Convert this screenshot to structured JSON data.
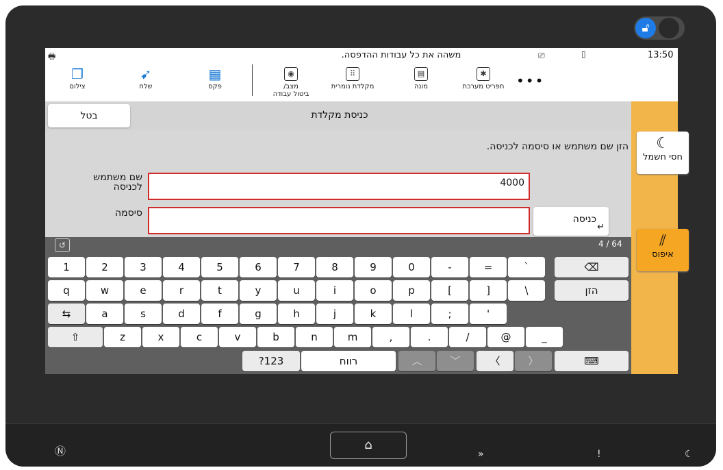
{
  "status": {
    "message": "משהה את כל עבודות ההדפסה.",
    "time": "13:50"
  },
  "functions": [
    {
      "label": "צילום",
      "icon": "copy-icon"
    },
    {
      "label": "שלח",
      "icon": "send-icon"
    },
    {
      "label": "פקס",
      "icon": "fax-icon"
    }
  ],
  "tools": [
    {
      "label_line1": "מצב/",
      "label_line2": "ביטול עבודה",
      "icon": "eye-icon"
    },
    {
      "label": "מקלדת נומרית",
      "icon": "numeric-keypad-icon"
    },
    {
      "label": "מונה",
      "icon": "counter-icon"
    },
    {
      "label": "תפריט מערכת",
      "icon": "system-menu-icon"
    }
  ],
  "more_label": "•••",
  "title_row": {
    "cancel_label": "בטל",
    "title": "כניסת מקלדת"
  },
  "login": {
    "instruction": "הזן שם משתמש או סיסמה לכניסה.",
    "username_label_line1": "שם משתמש",
    "username_label_line2": "לכניסה",
    "username_value": "4000",
    "password_label": "סיסמה",
    "password_value": "",
    "enter_label": "כניסה"
  },
  "keyboard": {
    "char_count": "4 / 64",
    "row1": [
      "1",
      "2",
      "3",
      "4",
      "5",
      "6",
      "7",
      "8",
      "9",
      "0",
      "-",
      "=",
      "`"
    ],
    "row2": [
      "q",
      "w",
      "e",
      "r",
      "t",
      "y",
      "u",
      "i",
      "o",
      "p",
      "[",
      "]",
      "\\"
    ],
    "row3": [
      "a",
      "s",
      "d",
      "f",
      "g",
      "h",
      "j",
      "k",
      "l",
      ";",
      "'"
    ],
    "row4": [
      "z",
      "x",
      "c",
      "v",
      "b",
      "n",
      "m",
      ",",
      ".",
      "/",
      "@",
      "_"
    ],
    "enter_key": "הזן",
    "symbols_key": "?123",
    "space_key": "רווח"
  },
  "side": {
    "sleep_label": "חסי חשמל",
    "reset_label": "איפוס"
  }
}
